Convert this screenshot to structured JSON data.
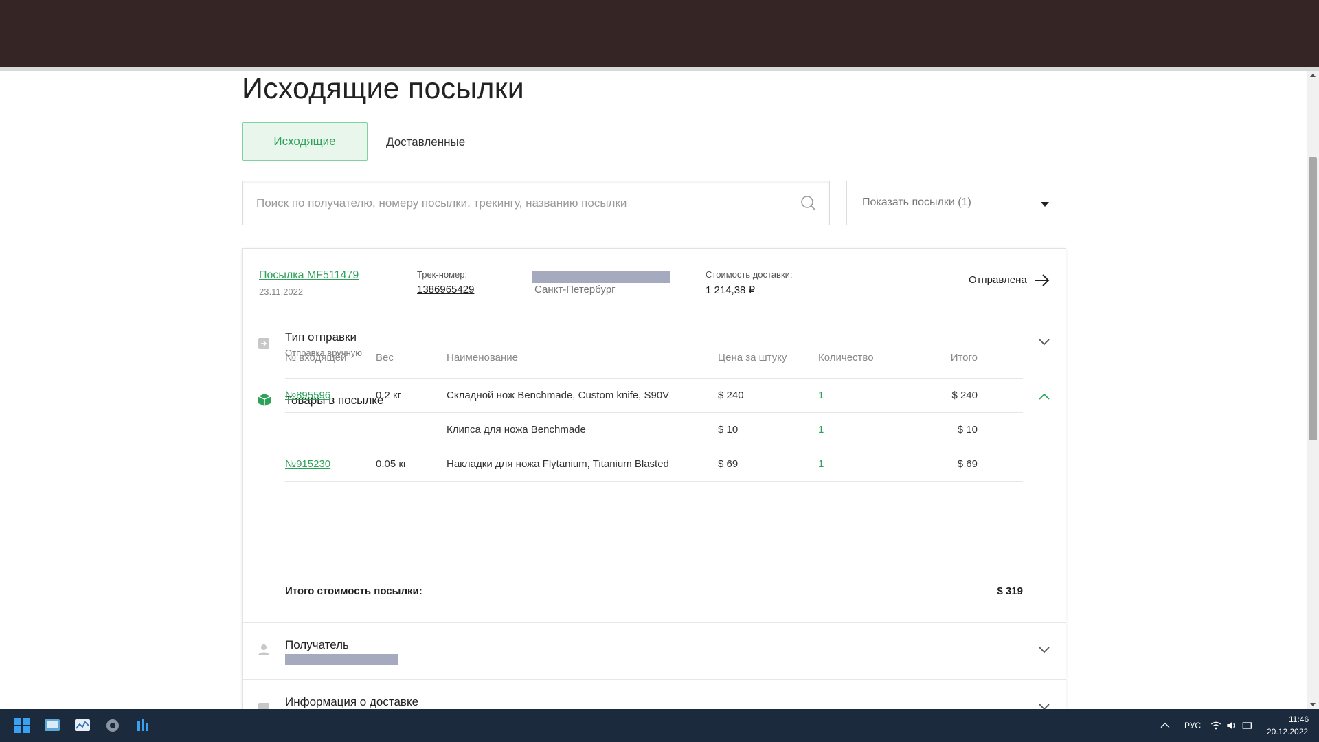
{
  "page": {
    "title": "Исходящие посылки",
    "tabs": [
      {
        "label": "Исходящие",
        "active": true
      },
      {
        "label": "Доставленные",
        "active": false
      }
    ]
  },
  "search": {
    "placeholder": "Поиск по получателю, номеру посылки, трекингу, названию посылки",
    "value": ""
  },
  "filter": {
    "label": "Показать посылки (1)"
  },
  "parcel": {
    "name": "Посылка MF511479",
    "date": "23.11.2022",
    "track_label": "Трек-номер:",
    "track_number": "1386965429",
    "city": "Санкт-Петербург",
    "cost_label": "Стоимость доставки:",
    "cost_value": "1 214,38 ₽",
    "status": "Отправлена"
  },
  "sections": {
    "send_type": {
      "title": "Тип отправки",
      "subtitle": "Отправка вручную"
    },
    "items": {
      "title": "Товары в посылке"
    },
    "recipient": {
      "title": "Получатель"
    },
    "delivery": {
      "title": "Информация о доставке"
    }
  },
  "items_table": {
    "headers": [
      "№ входящей",
      "Вес",
      "Наименование",
      "Цена за штуку",
      "Количество",
      "Итого"
    ],
    "rows": [
      {
        "incoming": "№895596",
        "weight": "0.2 кг",
        "name": "Складной нож Benchmade, Custom knife, S90V",
        "price": "$ 240",
        "qty": "1",
        "total": "$ 240"
      },
      {
        "incoming": "",
        "weight": "",
        "name": "Клипса для ножа Benchmade",
        "price": "$ 10",
        "qty": "1",
        "total": "$ 10"
      },
      {
        "incoming": "№915230",
        "weight": "0.05 кг",
        "name": "Накладки для ножа Flytanium, Titanium Blasted",
        "price": "$ 69",
        "qty": "1",
        "total": "$ 69"
      }
    ],
    "total_label": "Итого стоимость посылки:",
    "total_value": "$ 319"
  },
  "taskbar": {
    "lang": "РУС",
    "time": "11:46",
    "date": "20.12.2022"
  },
  "colors": {
    "accent_green": "#2fa15a",
    "header_dark": "#352525",
    "taskbar": "#1b2a3d",
    "redacted": "#a5aabf"
  }
}
